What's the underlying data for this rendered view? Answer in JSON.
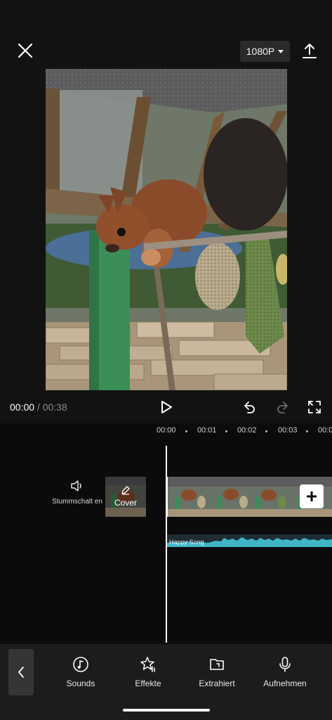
{
  "topbar": {
    "close_icon": "close-icon",
    "resolution": "1080P",
    "export_icon": "export-icon"
  },
  "playback": {
    "current_time": "00:00",
    "separator": " / ",
    "duration": "00:38"
  },
  "timeline": {
    "ticks": [
      "00:00",
      "00:01",
      "00:02",
      "00:03",
      "00:0"
    ],
    "mute_label": "Stummschalt en",
    "cover_label": "Cover",
    "audio_label": "Happy Song",
    "add_icon": "+",
    "accent_color": "#3fb6c8"
  },
  "toolbar": {
    "items": [
      {
        "label": "Sounds",
        "icon": "music-note-icon"
      },
      {
        "label": "Effekte",
        "icon": "star-effects-icon"
      },
      {
        "label": "Extrahiert",
        "icon": "folder-extract-icon"
      },
      {
        "label": "Aufnehmen",
        "icon": "microphone-icon"
      }
    ]
  }
}
